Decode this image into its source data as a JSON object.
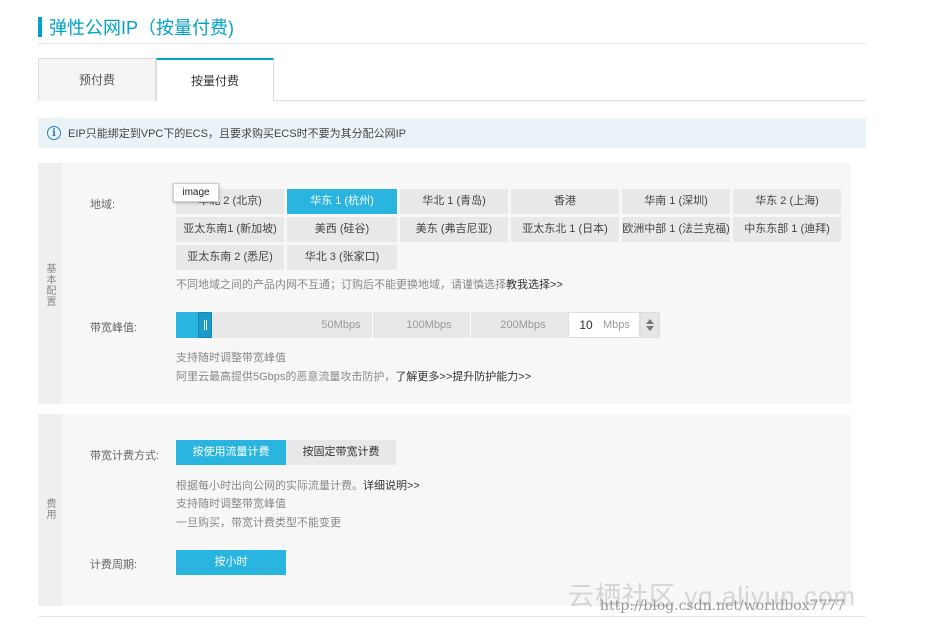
{
  "page": {
    "title": "弹性公网IP（按量付费)"
  },
  "tabs": [
    {
      "label": "预付费"
    },
    {
      "label": "按量付费"
    }
  ],
  "notice": {
    "icon": "info-icon",
    "text": "EIP只能绑定到VPC下的ECS，且要求购买ECS时不要为其分配公网IP"
  },
  "basic": {
    "side_label": "基本配置",
    "region_label": "地域:",
    "regions": [
      "华北 2 (北京)",
      "华东 1 (杭州)",
      "华北 1 (青岛)",
      "香港",
      "华南 1 (深圳)",
      "华东 2 (上海)",
      "亚太东南1 (新加坡)",
      "美西 (硅谷)",
      "美东 (弗吉尼亚)",
      "亚太东北 1 (日本)",
      "欧洲中部 1 (法兰克福)",
      "中东东部 1 (迪拜)",
      "亚太东南 2 (悉尼)",
      "华北 3 (张家口)"
    ],
    "selected_region": "华东 1 (杭州)",
    "region_hint": "不同地域之间的产品内网不互通；订购后不能更换地域，请谨慎选择",
    "region_hint_link": "教我选择>>",
    "bandwidth_label": "带宽峰值:",
    "bandwidth_ticks": [
      "50Mbps",
      "100Mbps",
      "200Mbps"
    ],
    "bandwidth_value": "10",
    "bandwidth_unit": "Mbps",
    "bandwidth_fill_fraction": 0.05,
    "bandwidth_hint1": "支持随时调整带宽峰值",
    "bandwidth_hint2": "阿里云最高提供5Gbps的恶意流量攻击防护，",
    "bandwidth_hint2_link": "了解更多>>提升防护能力>>"
  },
  "billing": {
    "side_label": "费用",
    "method_label": "带宽计费方式:",
    "method_on": "按使用流量计费",
    "method_off": "按固定带宽计费",
    "method_hint1": "根据每小时出向公网的实际流量计费。",
    "method_hint1_link": "详细说明>>",
    "method_hint2": "支持随时调整带宽峰值",
    "method_hint3": "一旦购买，带宽计费类型不能变更",
    "period_label": "计费周期:",
    "period_value": "按小时"
  },
  "tooltip": {
    "text": "image"
  },
  "watermark": {
    "text": "云栖社区 yq.aliyun.com",
    "url": "http://blog.csdn.net/worldbox7777"
  },
  "colors": {
    "accent": "#2ab4e0",
    "title": "#00a2ca"
  }
}
